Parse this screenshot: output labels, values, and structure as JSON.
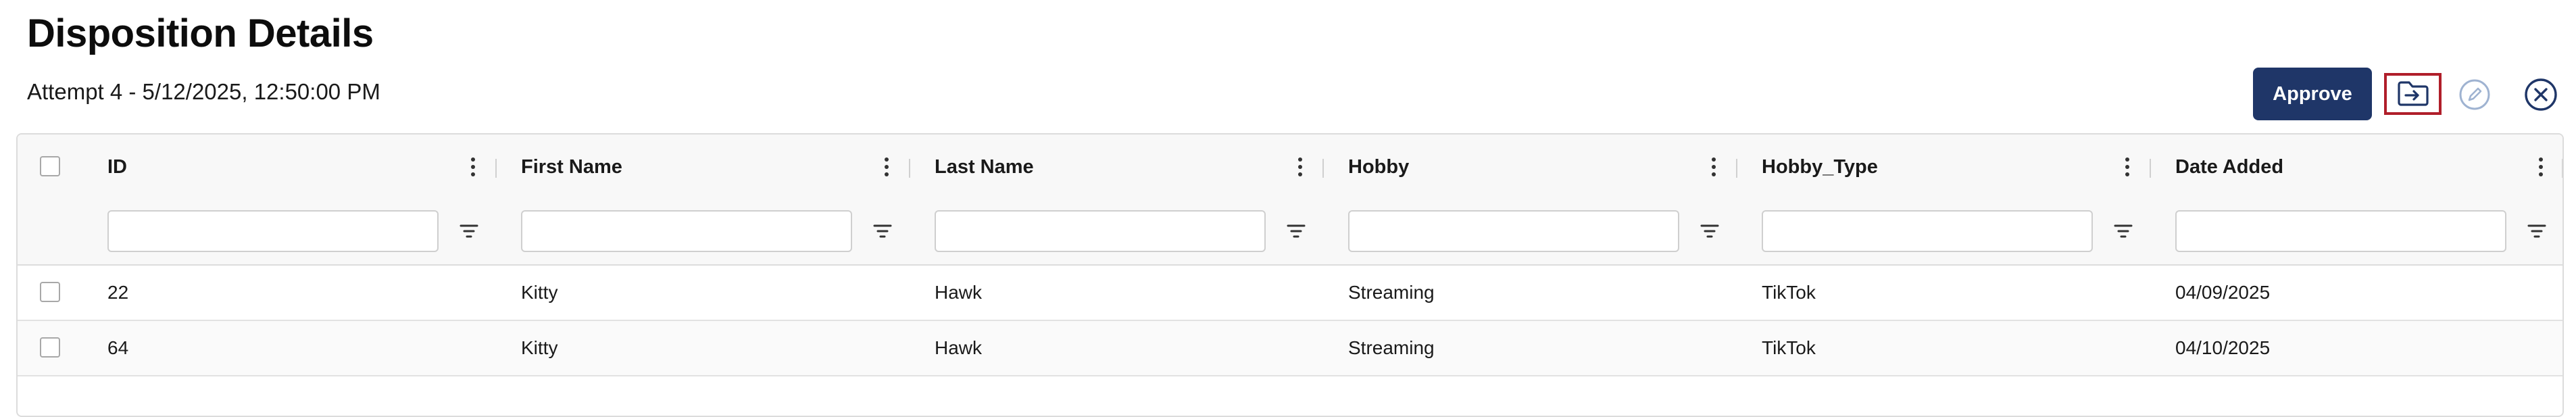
{
  "page": {
    "title": "Disposition Details",
    "subtitle": "Attempt 4 - 5/12/2025, 12:50:00 PM"
  },
  "toolbar": {
    "approve_label": "Approve",
    "import_icon": "import-file-icon",
    "edit_icon": "edit-circle-icon",
    "close_icon": "close-circle-icon"
  },
  "colors": {
    "primary": "#1f3668",
    "highlight_border": "#b01e2a",
    "header_bg": "#f8f8f8",
    "border": "#dcdcdc"
  },
  "table": {
    "columns": [
      {
        "key": "id",
        "label": "ID"
      },
      {
        "key": "first_name",
        "label": "First Name"
      },
      {
        "key": "last_name",
        "label": "Last Name"
      },
      {
        "key": "hobby",
        "label": "Hobby"
      },
      {
        "key": "hobby_type",
        "label": "Hobby_Type"
      },
      {
        "key": "date_added",
        "label": "Date Added"
      }
    ],
    "rows": [
      [
        "22",
        "Kitty",
        "Hawk",
        "Streaming",
        "TikTok",
        "04/09/2025"
      ],
      [
        "64",
        "Kitty",
        "Hawk",
        "Streaming",
        "TikTok",
        "04/10/2025"
      ]
    ]
  }
}
